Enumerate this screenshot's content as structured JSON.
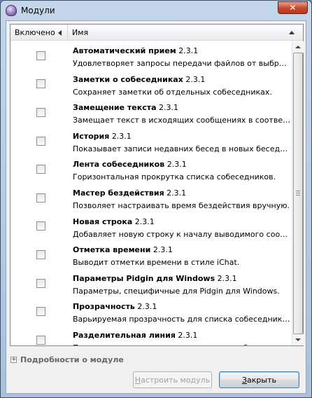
{
  "window": {
    "title": "Модули",
    "close_glyph": "✕"
  },
  "header": {
    "enabled_col": "Включено",
    "name_col": "Имя"
  },
  "plugins": [
    {
      "name": "Автоматический прием",
      "version": "2.3.1",
      "desc": "Удовлетворяет запросы передачи файлов от выбранн..."
    },
    {
      "name": "Заметки о собеседниках",
      "version": "2.3.1",
      "desc": "Сохраняет заметки об отдельных собеседниках."
    },
    {
      "name": "Замещение текста",
      "version": "2.3.1",
      "desc": "Замещает текст в исходящих сообщениях в соответств..."
    },
    {
      "name": "История",
      "version": "2.3.1",
      "desc": "Показывает записи недавних бесед в новых беседах."
    },
    {
      "name": "Лента собеседников",
      "version": "2.3.1",
      "desc": "Горизонтальная прокрутка списка собеседников."
    },
    {
      "name": "Мастер бездействия",
      "version": "2.3.1",
      "desc": "Позволяет настраивать время бездействия вручную."
    },
    {
      "name": "Новая строка",
      "version": "2.3.1",
      "desc": "Добавляет новую строку к началу выводимого сообщ..."
    },
    {
      "name": "Отметка времени",
      "version": "2.3.1",
      "desc": "Выводит отметки времени в стиле iChat."
    },
    {
      "name": "Параметры Pidgin для Windows",
      "version": "2.3.1",
      "desc": "Параметры, специфичные для Pidgin для Windows."
    },
    {
      "name": "Прозрачность",
      "version": "2.3.1",
      "desc": "Варьируемая прозрачность для списка собеседников ..."
    },
    {
      "name": "Разделительная линия",
      "version": "2.3.1",
      "desc": "Проводит линию, отделяющую новые сообщения в б..."
    }
  ],
  "details": {
    "expander": "+",
    "label": "Подробности о модуле"
  },
  "buttons": {
    "configure_mnemonic": "Н",
    "configure_rest": "астроить модуль",
    "close_mnemonic": "З",
    "close_rest": "акрыть"
  }
}
